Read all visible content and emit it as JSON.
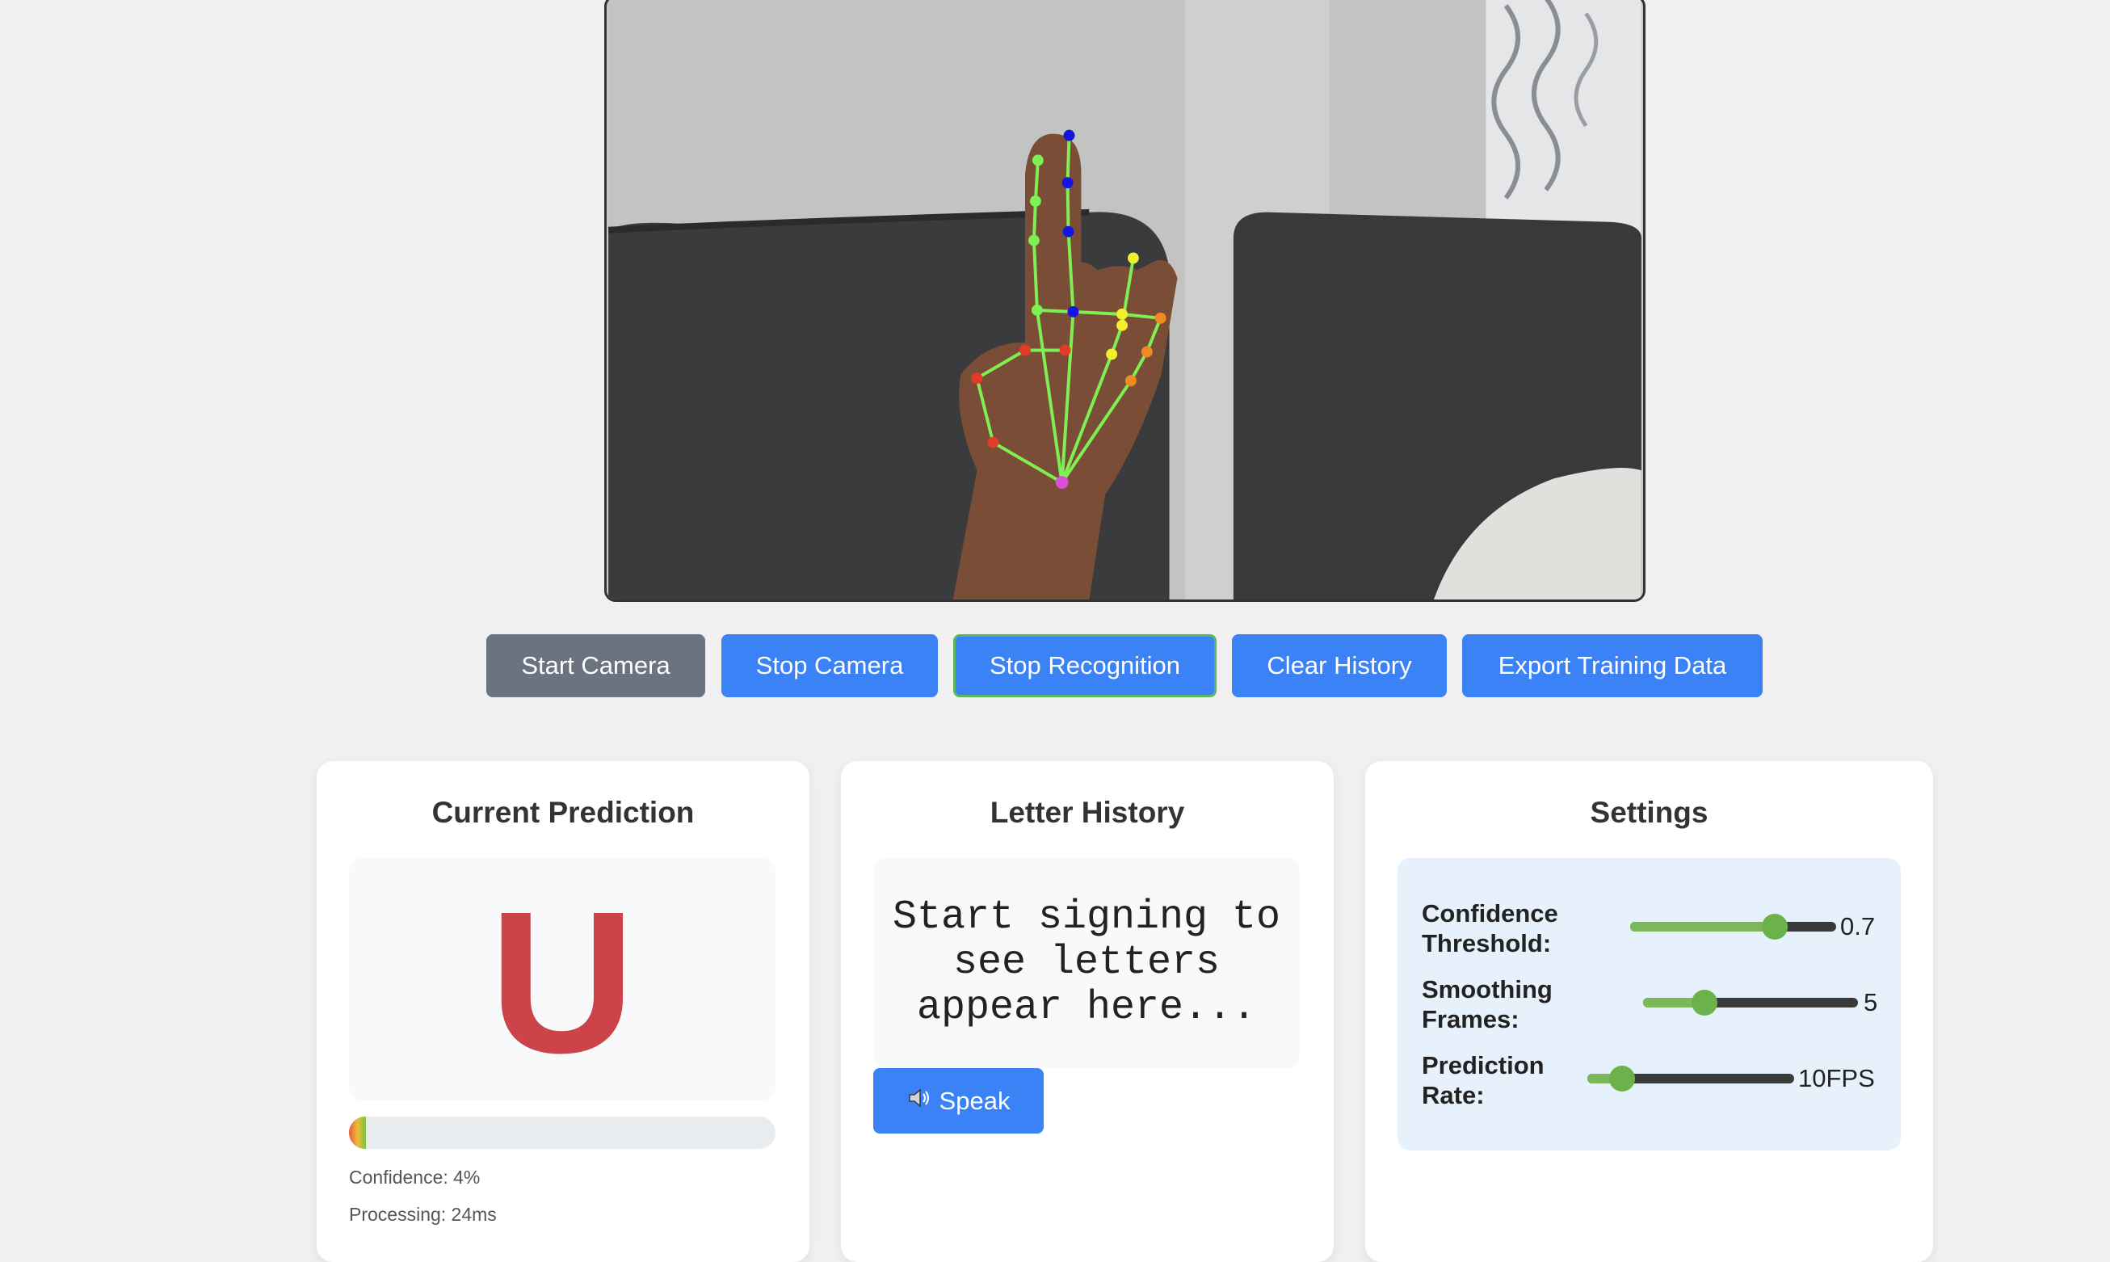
{
  "controls": {
    "start_camera": "Start Camera",
    "stop_camera": "Stop Camera",
    "stop_recognition": "Stop Recognition",
    "clear_history": "Clear History",
    "export_training_data": "Export Training Data"
  },
  "prediction": {
    "title": "Current Prediction",
    "letter": "U",
    "confidence_fraction": 0.04,
    "confidence_text": "Confidence: 4%",
    "processing_text": "Processing: 24ms"
  },
  "history": {
    "title": "Letter History",
    "placeholder": "Start signing to see letters appear here...",
    "speak_icon": "speaker-icon",
    "speak_label": "Speak"
  },
  "settings": {
    "title": "Settings",
    "confidence_threshold": {
      "label_line1": "Confidence",
      "label_line2": "Threshold:",
      "value": 0.7,
      "min": 0,
      "max": 1,
      "display": "0.7"
    },
    "smoothing_frames": {
      "label_line1": "Smoothing",
      "label_line2": "Frames:",
      "value": 5,
      "min": 1,
      "max": 15,
      "display": "5"
    },
    "prediction_rate": {
      "label_line1": "Prediction",
      "label_line2": "Rate:",
      "value": 10,
      "min": 5,
      "max": 35,
      "display": "10FPS"
    }
  },
  "colors": {
    "primary_button": "#3b82f6",
    "disabled_button": "#6b7280",
    "active_border": "#5cb85c",
    "prediction_letter": "#cc4349",
    "slider_fill": "#7ab85a"
  }
}
